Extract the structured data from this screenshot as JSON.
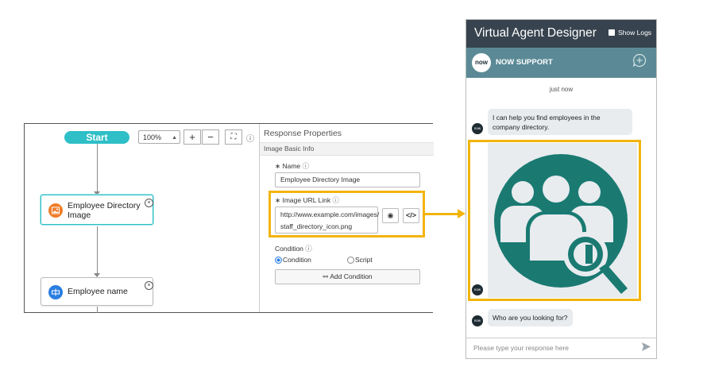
{
  "designer": {
    "start_label": "Start",
    "zoom_value": "100%",
    "zoom_in_label": "+",
    "zoom_out_label": "−",
    "fit_icon": "⛶",
    "info_icon": "ⓘ",
    "nodes": [
      {
        "label": "Employee Directory Image",
        "icon": "image-icon",
        "color": "#f07e2a"
      },
      {
        "label": "Employee name",
        "icon": "text-input-icon",
        "color": "#2a7ee0"
      }
    ]
  },
  "panel": {
    "title": "Response Properties",
    "section": "Image Basic Info",
    "name_label": "Name",
    "name_value": "Employee Directory Image",
    "url_label": "Image URL Link",
    "url_value_line1": "http://www.example.com/images/",
    "url_value_line2": "staff_directory_icon.png",
    "condition_label": "Condition",
    "condition_option": "Condition",
    "script_option": "Script",
    "condition_selected": "Condition",
    "add_condition": "Add Condition"
  },
  "chat": {
    "title": "Virtual Agent Designer",
    "show_logs": "Show Logs",
    "brand_logo": "now",
    "brand_name": "NOW SUPPORT",
    "timestamp": "just now",
    "message1": "I can help you find employees in the company directory.",
    "message2": "Who are you looking for?",
    "input_placeholder": "Please type your response here"
  },
  "colors": {
    "accent_teal": "#2ebfc7",
    "highlight": "#f2b40d",
    "chat_header": "#37434e",
    "chat_subheader": "#5b8a96",
    "icon_teal": "#1a7a72"
  }
}
